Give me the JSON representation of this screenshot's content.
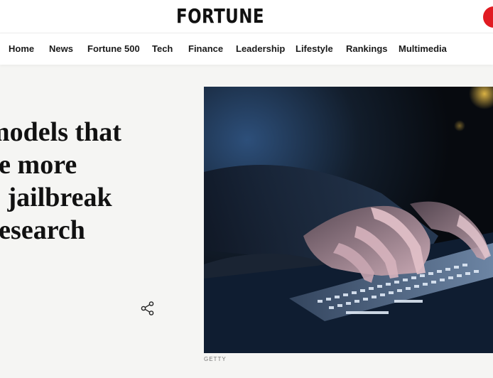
{
  "header": {
    "logo_text": "FORTUNE",
    "brand_color": "#e11b22"
  },
  "nav": {
    "items": [
      {
        "label": "Home"
      },
      {
        "label": "News"
      },
      {
        "label": "Fortune 500"
      },
      {
        "label": "Tech"
      },
      {
        "label": "Finance"
      },
      {
        "label": "Leadership"
      },
      {
        "label": "Lifestyle"
      },
      {
        "label": "Rankings"
      },
      {
        "label": "Multimedia"
      }
    ]
  },
  "article": {
    "headline_lines": [
      "models that",
      "re more",
      "o jailbreak",
      "research"
    ],
    "share_icon": "share-icon",
    "image_credit": "GETTY"
  }
}
